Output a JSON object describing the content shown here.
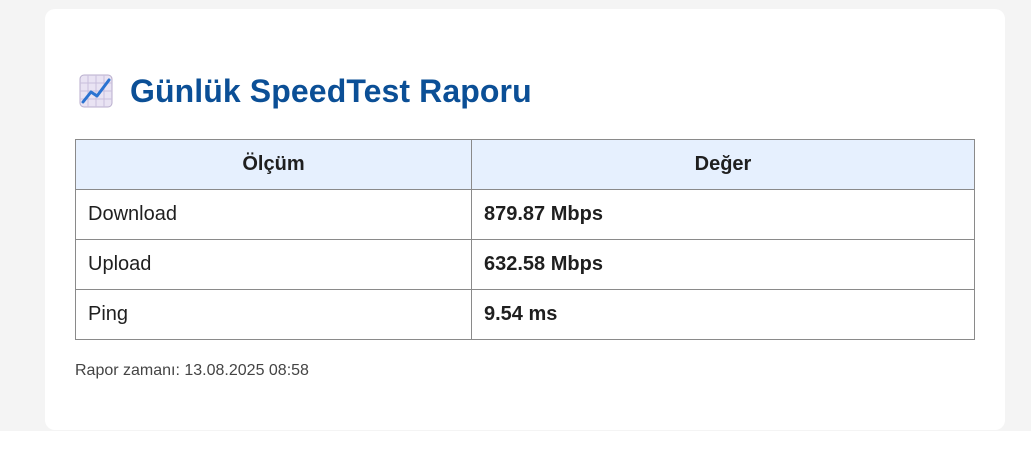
{
  "report": {
    "title_icon": "chart-increasing-icon",
    "title": "Günlük SpeedTest Raporu",
    "table": {
      "headers": [
        "Ölçüm",
        "Değer"
      ],
      "rows": [
        {
          "metric": "Download",
          "value": "879.87 Mbps"
        },
        {
          "metric": "Upload",
          "value": "632.58 Mbps"
        },
        {
          "metric": "Ping",
          "value": "9.54 ms"
        }
      ]
    },
    "timestamp": "Rapor zamanı: 13.08.2025 08:58"
  },
  "colors": {
    "title": "#0b4f96",
    "header_bg": "#e6f0fe",
    "border": "#8a8a8a",
    "page_bg": "#f4f4f4"
  }
}
